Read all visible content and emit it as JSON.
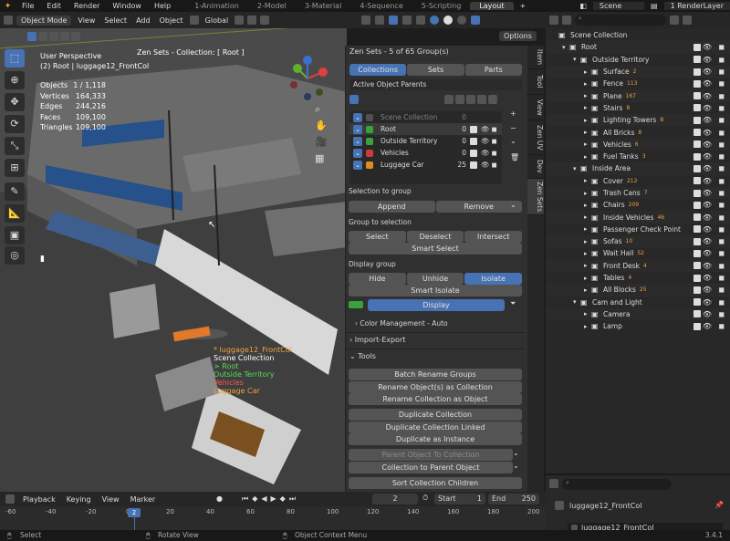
{
  "menu": {
    "items": [
      "File",
      "Edit",
      "Render",
      "Window",
      "Help"
    ],
    "workspaces": [
      "1-Animation",
      "2-Model",
      "3-Material",
      "4-Sequence",
      "5-Scripting",
      "Layout"
    ],
    "active_workspace": "Layout",
    "scene": "Scene",
    "render_layer": "1 RenderLayer"
  },
  "viewport_header": {
    "mode": "Object Mode",
    "view": "View",
    "select": "Select",
    "add": "Add",
    "object": "Object",
    "transform": "Global",
    "options": "Options"
  },
  "viewport": {
    "perspective": "User Perspective",
    "context": "(2) Root | luggage12_FrontCol",
    "zen_overlay": "Zen Sets - Collection: [ Root ]",
    "stats": [
      {
        "label": "Objects",
        "value": "1 / 1,118"
      },
      {
        "label": "Vertices",
        "value": "164,333"
      },
      {
        "label": "Edges",
        "value": "244,216"
      },
      {
        "label": "Faces",
        "value": "109,100"
      },
      {
        "label": "Triangles",
        "value": "109,100"
      }
    ],
    "labels": [
      {
        "text": "* luggage12_FrontCol",
        "color": "#f0a040"
      },
      {
        "text": "Scene Collection",
        "color": "#ffffff"
      },
      {
        "text": "> Root",
        "color": "#55dd55"
      },
      {
        "text": "Outside Territory",
        "color": "#55dd55"
      },
      {
        "text": "Vehicles",
        "color": "#ff5555"
      },
      {
        "text": "Luggage Car",
        "color": "#f0a040"
      }
    ]
  },
  "npanel": {
    "title": "Zen Sets - 5 of 65 Group(s)",
    "modes": [
      "Collections",
      "Sets",
      "Parts"
    ],
    "filter": "Active Object Parents",
    "groups": [
      {
        "name": "Scene Collection",
        "count": "0",
        "color": "#505050",
        "dim": true
      },
      {
        "name": "Root",
        "count": "0",
        "color": "#3aa23a",
        "dim": false
      },
      {
        "name": "Outside Territory",
        "count": "0",
        "color": "#3aa23a",
        "dim": false
      },
      {
        "name": "Vehicles",
        "count": "0",
        "color": "#cc3a3a",
        "dim": false
      },
      {
        "name": "Luggage Car",
        "count": "25",
        "color": "#e08a20",
        "dim": false
      }
    ],
    "selection_to_group": "Selection to group",
    "append": "Append",
    "remove": "Remove",
    "group_to_selection": "Group to selection",
    "select": "Select",
    "deselect": "Deselect",
    "intersect": "Intersect",
    "smart_select": "Smart Select",
    "display_group": "Display group",
    "hide": "Hide",
    "unhide": "Unhide",
    "isolate": "Isolate",
    "smart_isolate": "Smart Isolate",
    "display": "Display",
    "color_mgmt": "Color Management - Auto",
    "import_export": "Import-Export",
    "tools": "Tools",
    "tool_buttons": [
      "Batch Rename Groups",
      "Rename Object(s) as Collection",
      "Rename Collection as Object",
      "Duplicate Collection",
      "Duplicate Collection Linked",
      "Duplicate as Instance",
      "Parent Object To Collection",
      "Collection to Parent Object",
      "Sort Collection Children"
    ],
    "tabs": [
      "Item",
      "Tool",
      "View",
      "Zen UV",
      "Dev",
      "Zen Sets"
    ]
  },
  "outliner": {
    "rows": [
      {
        "name": "Scene Collection",
        "level": 0,
        "badge": ""
      },
      {
        "name": "Root",
        "level": 1,
        "badge": ""
      },
      {
        "name": "Outside Territory",
        "level": 2,
        "badge": ""
      },
      {
        "name": "Surface",
        "level": 3,
        "badge": "2"
      },
      {
        "name": "Fence",
        "level": 3,
        "badge": "113"
      },
      {
        "name": "Plane",
        "level": 3,
        "badge": "167"
      },
      {
        "name": "Stairs",
        "level": 3,
        "badge": "8"
      },
      {
        "name": "Lighting Towers",
        "level": 3,
        "badge": "8"
      },
      {
        "name": "All Bricks",
        "level": 3,
        "badge": "8"
      },
      {
        "name": "Vehicles",
        "level": 3,
        "badge": "6"
      },
      {
        "name": "Fuel Tanks",
        "level": 3,
        "badge": "3"
      },
      {
        "name": "Inside Area",
        "level": 2,
        "badge": ""
      },
      {
        "name": "Cover",
        "level": 3,
        "badge": "212"
      },
      {
        "name": "Trash Cans",
        "level": 3,
        "badge": "7"
      },
      {
        "name": "Chairs",
        "level": 3,
        "badge": "209"
      },
      {
        "name": "Inside Vehicles",
        "level": 3,
        "badge": "46"
      },
      {
        "name": "Passenger Check Point",
        "level": 3,
        "badge": ""
      },
      {
        "name": "Sofas",
        "level": 3,
        "badge": "10"
      },
      {
        "name": "Wait Hall",
        "level": 3,
        "badge": "52"
      },
      {
        "name": "Front Desk",
        "level": 3,
        "badge": "4"
      },
      {
        "name": "Tables",
        "level": 3,
        "badge": "4"
      },
      {
        "name": "All Blocks",
        "level": 3,
        "badge": "25"
      },
      {
        "name": "Cam and Light",
        "level": 2,
        "badge": ""
      },
      {
        "name": "Camera",
        "level": 3,
        "badge": ""
      },
      {
        "name": "Lamp",
        "level": 3,
        "badge": ""
      }
    ],
    "props_object": "luggage12_FrontCol",
    "props_object2": "luggage12_FrontCol"
  },
  "timeline": {
    "playback": "Playback",
    "keying": "Keying",
    "view": "View",
    "marker": "Marker",
    "current": "2",
    "start_label": "Start",
    "start": "1",
    "end_label": "End",
    "end": "250",
    "ticks": [
      "-60",
      "-40",
      "-20",
      "0",
      "20",
      "40",
      "60",
      "80",
      "100",
      "120",
      "140",
      "160",
      "180",
      "200"
    ]
  },
  "statusbar": {
    "select": "Select",
    "rotate": "Rotate View",
    "context": "Object Context Menu",
    "version": "3.4.1"
  }
}
